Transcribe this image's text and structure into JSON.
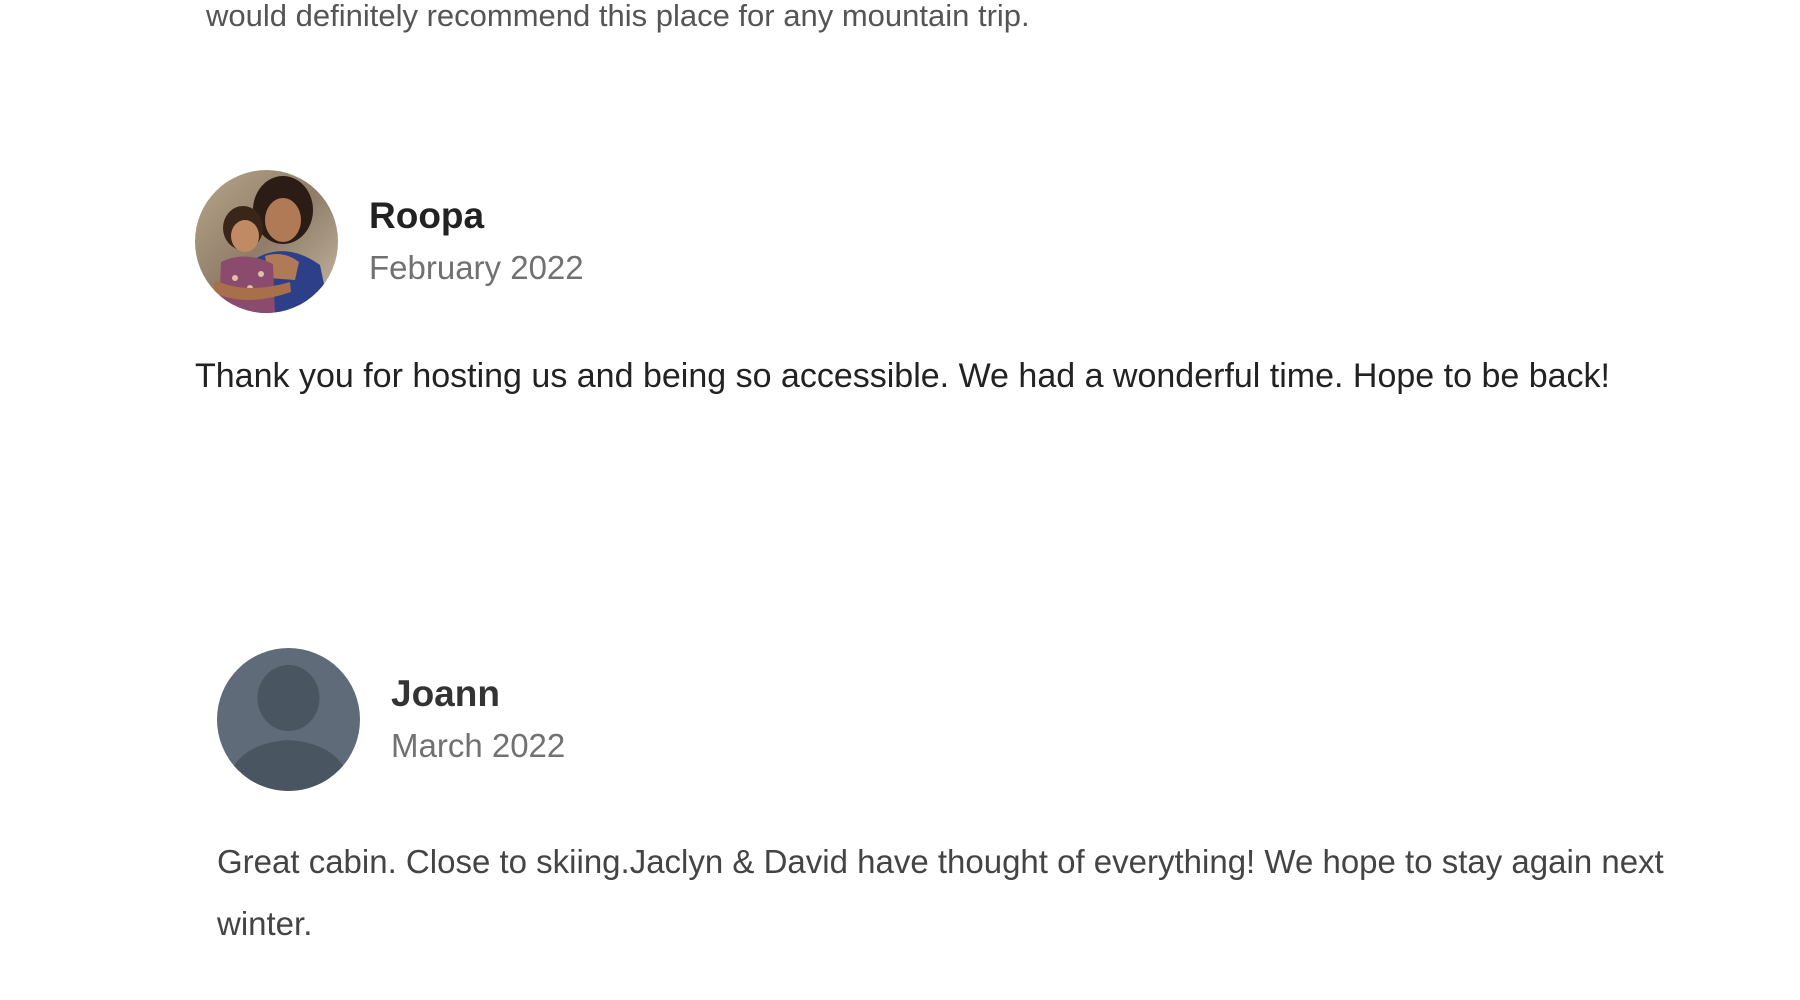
{
  "previous_review": {
    "text_tail": "would definitely recommend this place for any mountain trip."
  },
  "reviews": [
    {
      "name": "Roopa",
      "date": "February 2022",
      "text": "Thank you for hosting us and being so accessible. We had a wonderful time. Hope to be back!",
      "avatar": "photo-avatar"
    },
    {
      "name": "Joann",
      "date": "March 2022",
      "text": "Great cabin. Close to skiing.Jaclyn & David have thought of everything! We hope to stay again next winter.",
      "avatar": "default-user-icon"
    }
  ],
  "colors": {
    "text_primary": "#222222",
    "text_secondary": "#717171",
    "default_avatar_bg": "#5f6b78",
    "default_avatar_fg": "#4a5562"
  }
}
